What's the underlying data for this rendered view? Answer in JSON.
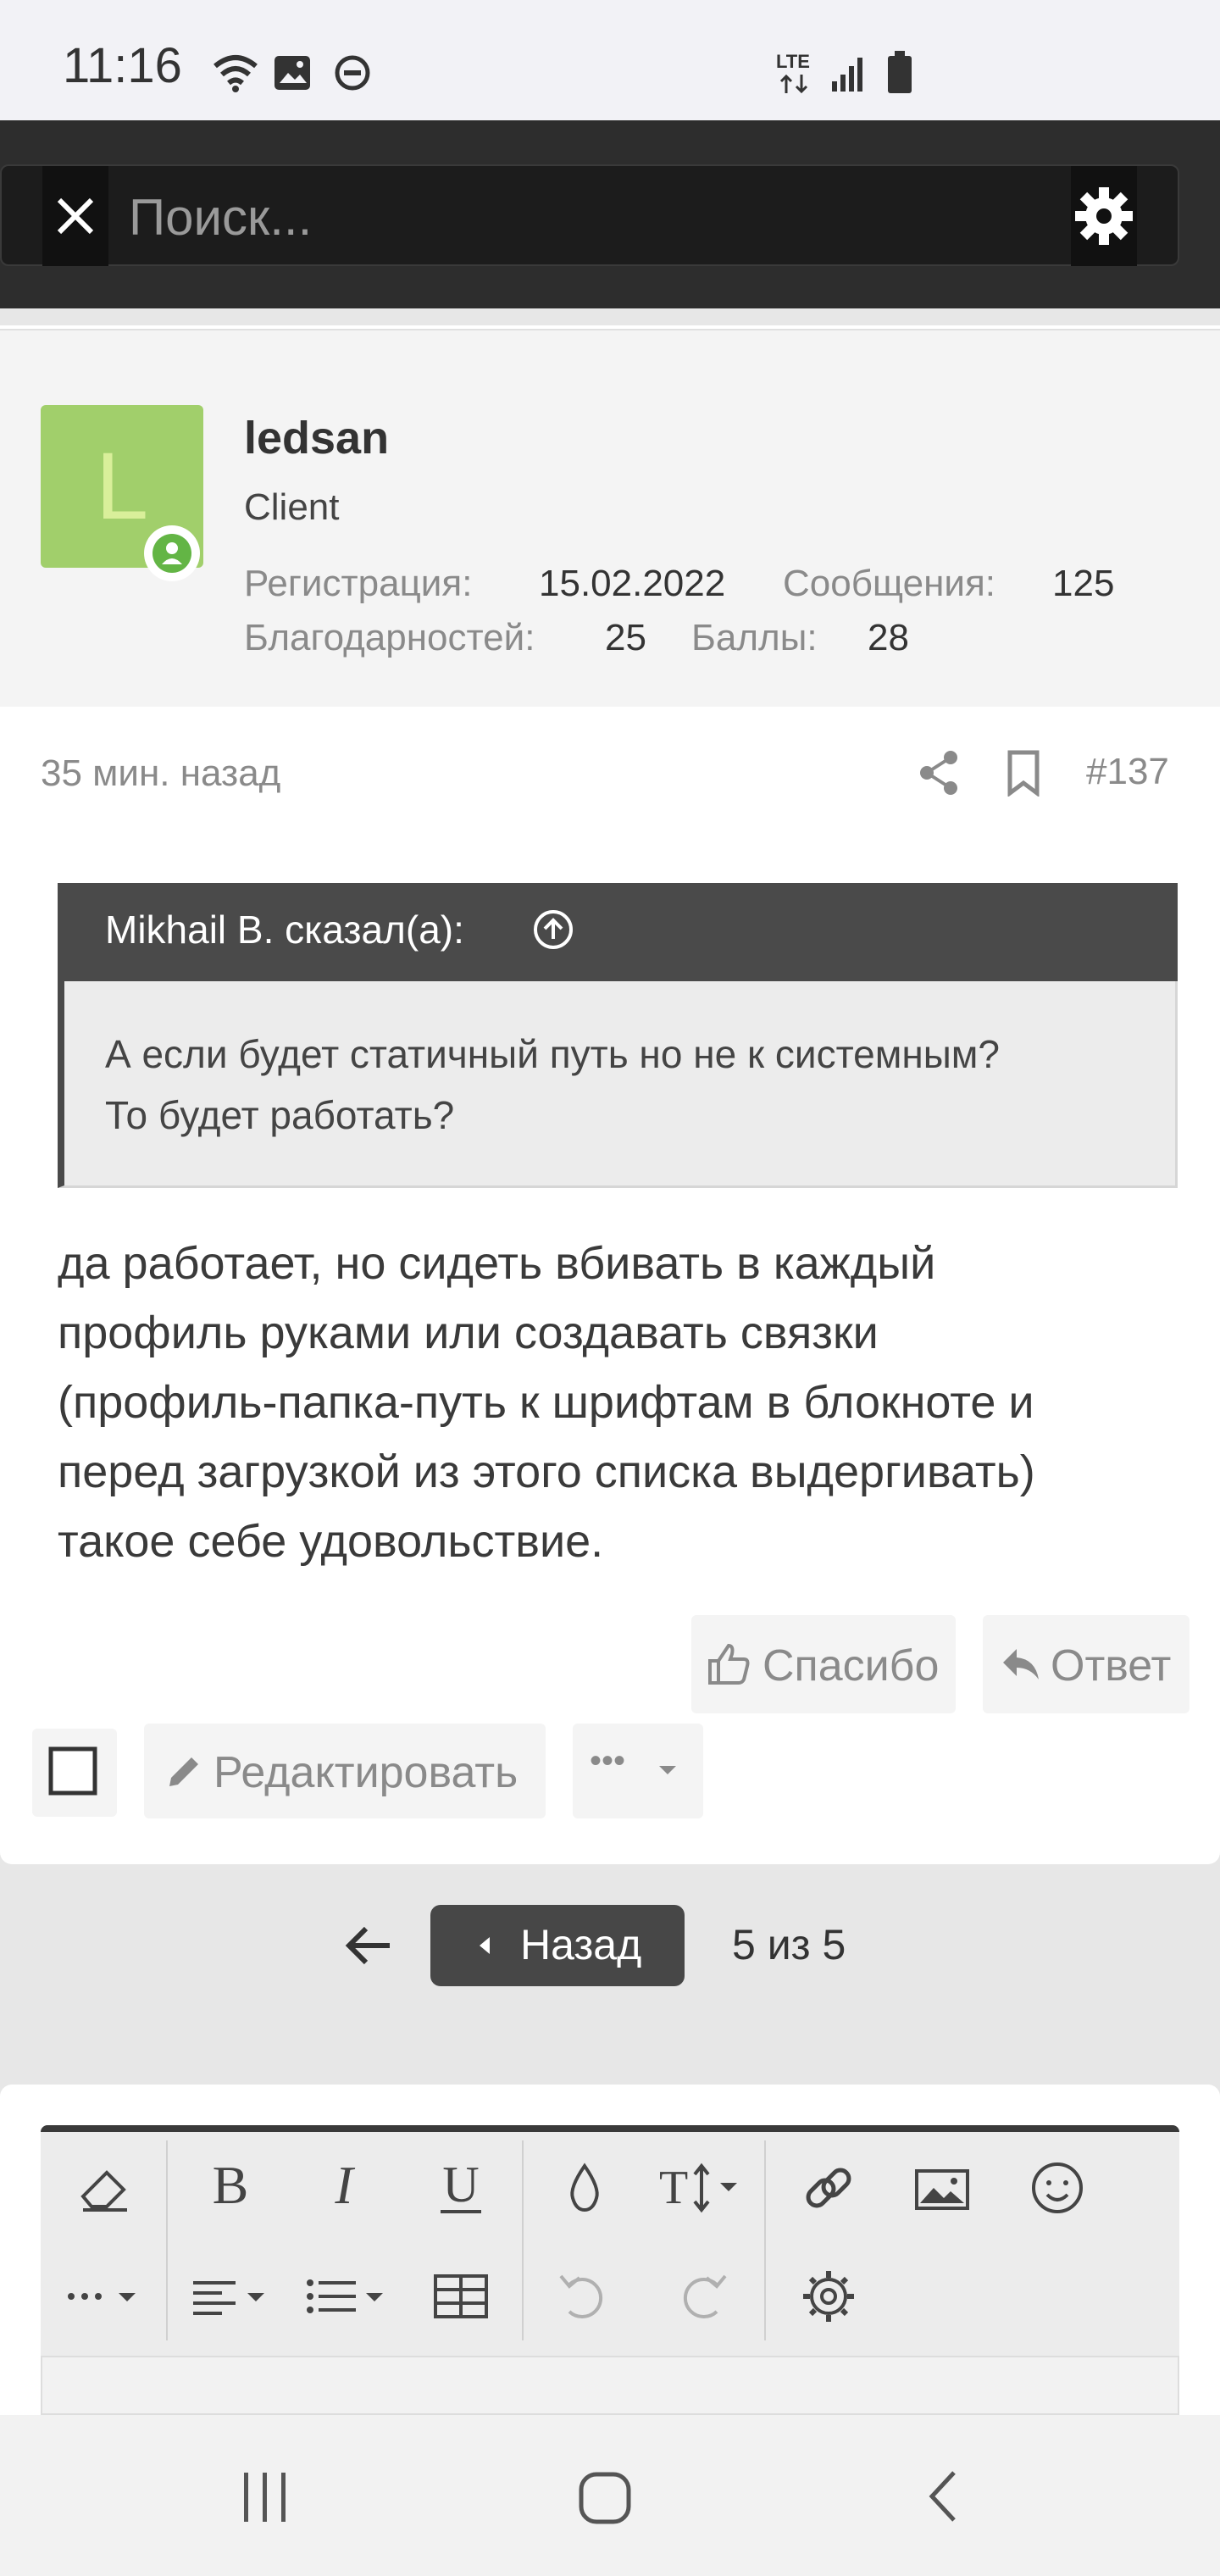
{
  "status_bar": {
    "time": "11:16",
    "network": "LTE"
  },
  "search": {
    "placeholder": "Поиск..."
  },
  "user": {
    "avatar_letter": "L",
    "name": "ledsan",
    "title": "Client",
    "registration_label": "Регистрация:",
    "registration_value": "15.02.2022",
    "messages_label": "Сообщения:",
    "messages_value": "125",
    "thanks_label": "Благодарностей:",
    "thanks_value": "25",
    "points_label": "Баллы:",
    "points_value": "28"
  },
  "post": {
    "time": "35 мин. назад",
    "number": "#137",
    "quote_author": "Mikhail B. сказал(а):",
    "quote_lines": [
      "А если будет статичный путь но не к системным?",
      "То будет работать?"
    ],
    "body_lines": [
      "да работает, но сидеть вбивать в каждый",
      "профиль руками или создавать связки",
      "(профиль-папка-путь к шрифтам в блокноте и",
      "перед загрузкой из этого списка выдергивать)",
      "такое себе удовольствие."
    ],
    "thanks_button": "Спасибо",
    "reply_button": "Ответ",
    "edit_button": "Редактировать",
    "more_button": "•••"
  },
  "pagination": {
    "back_label": "Назад",
    "page_info": "5 из 5"
  },
  "colors": {
    "accent": "#474747",
    "online": "#63b545",
    "avatar": "#a1cf6b"
  }
}
